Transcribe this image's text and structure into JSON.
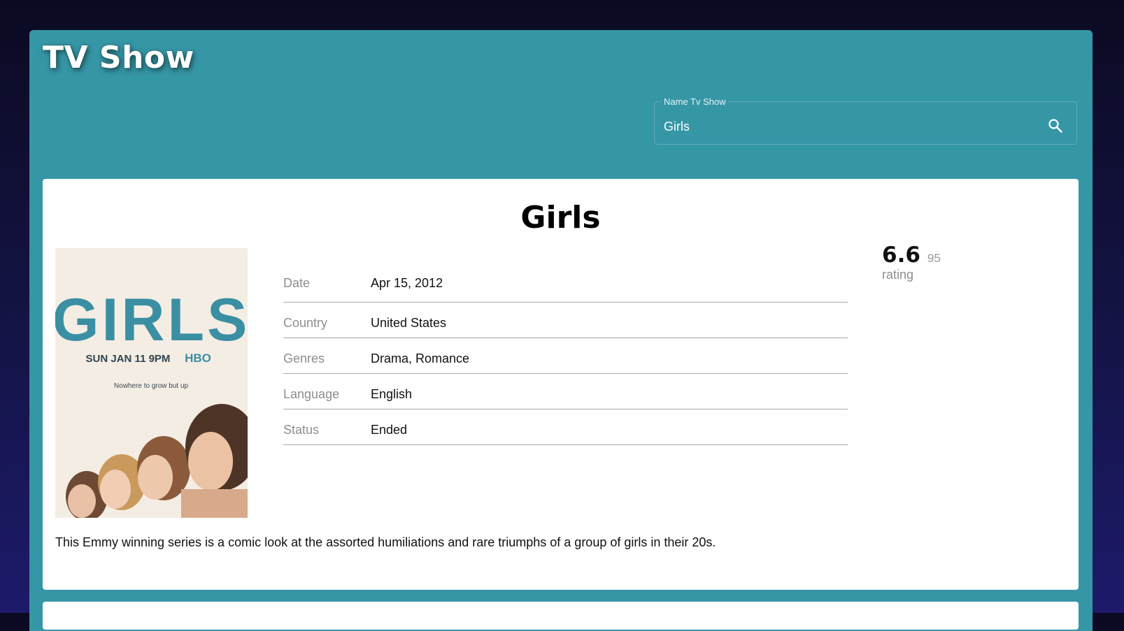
{
  "app": {
    "title": "TV Show"
  },
  "search": {
    "label": "Name Tv Show",
    "value": "Girls",
    "icon": "search-icon"
  },
  "show": {
    "title": "Girls",
    "poster": {
      "wordmark": "GIRLS",
      "airing": "SUN JAN 11 9PM",
      "network": "HBO",
      "tagline": "Nowhere to grow but up"
    },
    "details": [
      {
        "label": "Date",
        "value": "Apr 15, 2012"
      },
      {
        "label": "Country",
        "value": "United States"
      },
      {
        "label": "Genres",
        "value": "Drama, Romance"
      },
      {
        "label": "Language",
        "value": "English"
      },
      {
        "label": "Status",
        "value": "Ended"
      }
    ],
    "rating": {
      "value": "6.6",
      "votes": "95",
      "label": "rating"
    },
    "summary": "This Emmy winning series is a comic look at the assorted humiliations and rare triumphs of a group of girls in their 20s."
  },
  "colors": {
    "panel": "#3596a6",
    "background_top": "#0b0a22",
    "background_bottom": "#1d1a6a",
    "card": "#ffffff",
    "poster_brand": "#3a8fa3"
  }
}
